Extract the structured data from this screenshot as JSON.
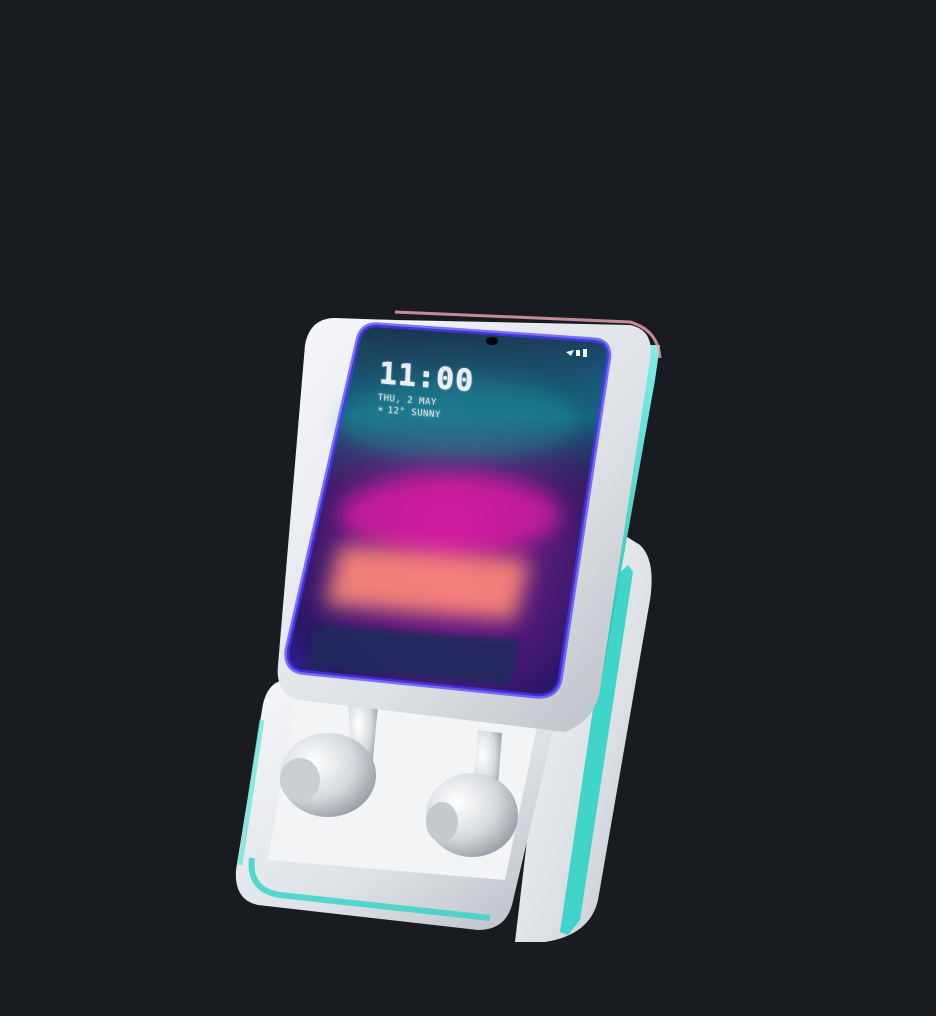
{
  "lockscreen": {
    "time": "11:00",
    "date": "THU, 2 MAY",
    "weather": "12° SUNNY",
    "weather_icon": "sun-icon"
  },
  "colors": {
    "background": "#181b20",
    "case_body": "#e9ecef",
    "accent_teal": "#2fd3c6",
    "screen_top": "#0d6e78",
    "screen_mid": "#c2159f",
    "screen_glow": "#ff8a78"
  }
}
